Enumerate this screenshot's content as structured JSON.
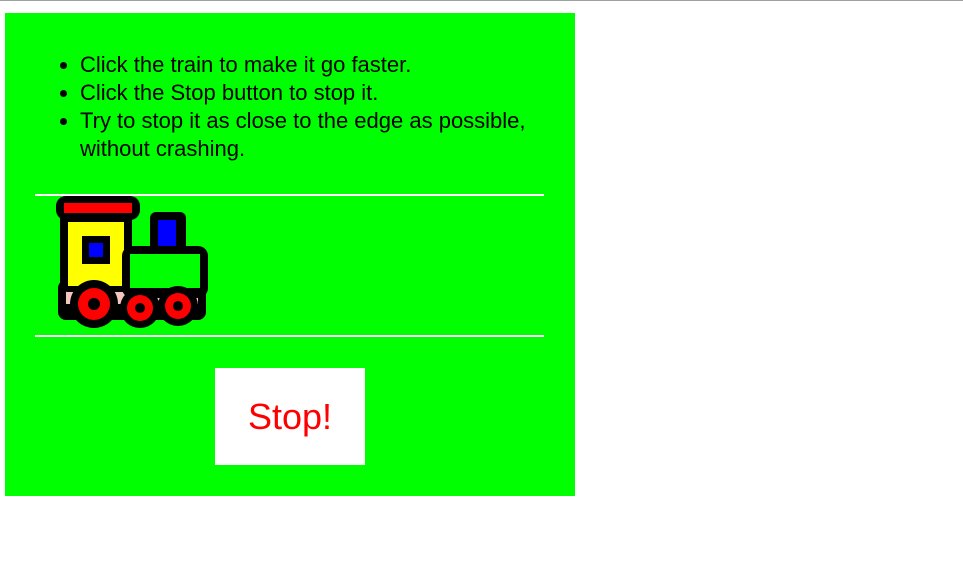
{
  "instructions": [
    "Click the train to make it go faster.",
    "Click the Stop button to stop it.",
    "Try to stop it as close to the edge as possible, without crashing."
  ],
  "stop_button": {
    "label": "Stop!"
  },
  "train": {
    "icon": "train-icon"
  },
  "colors": {
    "panel_background": "#00ff00",
    "track_lines": "#ffffff",
    "stop_label": "#ff0000",
    "train_body": "#00ff00",
    "train_cab": "#ffff00",
    "train_roof": "#ff0000",
    "train_windows": "#0000ff",
    "train_wheels": "#ff0000"
  }
}
